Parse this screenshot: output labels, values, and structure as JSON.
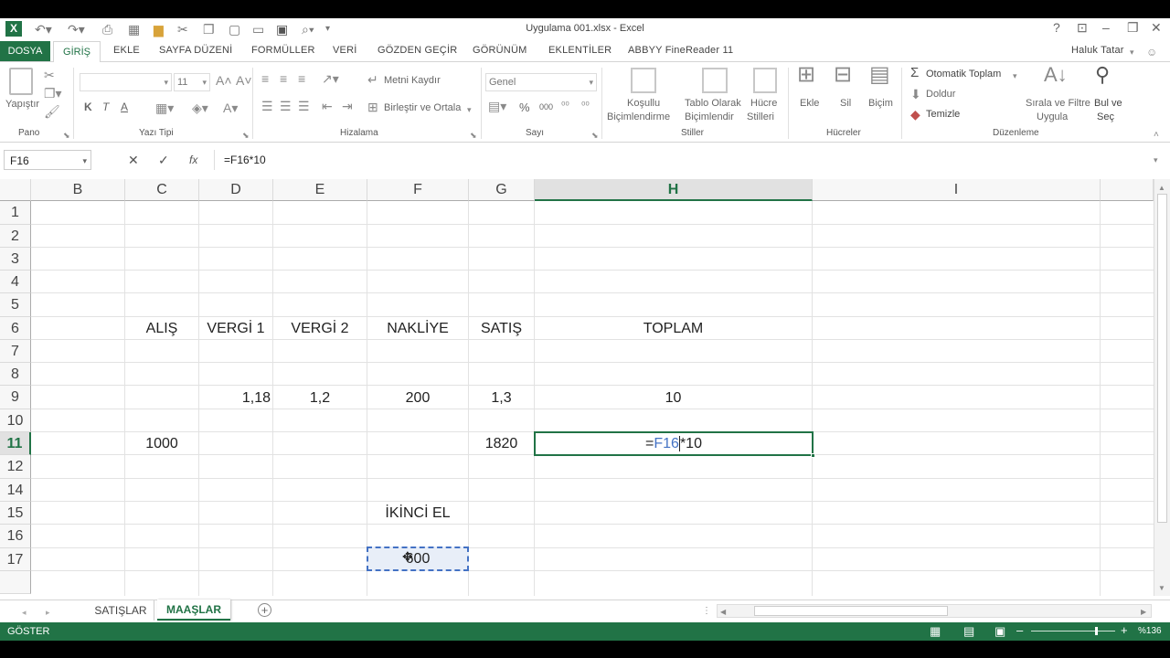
{
  "window": {
    "title": "Uygulama 001.xlsx - Excel",
    "user": "Haluk Tatar"
  },
  "ribbon_tabs": [
    "DOSYA",
    "GİRİŞ",
    "EKLE",
    "SAYFA DÜZENİ",
    "FORMÜLLER",
    "VERİ",
    "GÖZDEN GEÇİR",
    "GÖRÜNÜM",
    "EKLENTİLER",
    "ABBYY FineReader 11"
  ],
  "ribbon": {
    "pano": {
      "paste": "Yapıştır",
      "label": "Pano"
    },
    "font": {
      "size": "11",
      "bold": "K",
      "italic": "T",
      "underline": "A",
      "label": "Yazı Tipi"
    },
    "align": {
      "wrap": "Metni Kaydır",
      "merge": "Birleştir ve Ortala",
      "label": "Hizalama"
    },
    "number": {
      "format": "Genel",
      "percent": "%",
      "thousands": "000",
      "label": "Sayı"
    },
    "styles": {
      "cond_1": "Koşullu",
      "cond_2": "Biçimlendirme",
      "table_1": "Tablo Olarak",
      "table_2": "Biçimlendir",
      "cell_1": "Hücre",
      "cell_2": "Stilleri",
      "label": "Stiller"
    },
    "cells": {
      "insert": "Ekle",
      "delete": "Sil",
      "format": "Biçim",
      "label": "Hücreler"
    },
    "editing": {
      "autosum": "Otomatik Toplam",
      "fill": "Doldur",
      "clear": "Temizle",
      "sort_1": "Sırala ve Filtre",
      "sort_2": "Uygula",
      "find_1": "Bul ve",
      "find_2": "Seç",
      "label": "Düzenleme"
    }
  },
  "formula_bar": {
    "name_box": "F16",
    "fx": "fx",
    "formula": "=F16*10"
  },
  "columns": [
    "B",
    "C",
    "D",
    "E",
    "F",
    "G",
    "H",
    "I"
  ],
  "rows": [
    "1",
    "2",
    "3",
    "4",
    "5",
    "6",
    "7",
    "8",
    "9",
    "10",
    "11",
    "12",
    "14",
    "15",
    "16",
    "17"
  ],
  "cells": {
    "C6": "ALIŞ",
    "D6": "VERGİ 1",
    "E6": "VERGİ 2",
    "F6": "NAKLİYE",
    "G6": "SATIŞ",
    "H6": "TOPLAM",
    "D9": "1,18",
    "E9": "1,2",
    "F9": "200",
    "G9": "1,3",
    "H9": "10",
    "C11": "1000",
    "G11": "1820",
    "H11_eq": "=",
    "H11_ref": "F16",
    "H11_rest": "*10",
    "F14": "İKİNCİ EL",
    "F16": "600"
  },
  "sheets": [
    "SATIŞLAR",
    "MAAŞLAR"
  ],
  "status": {
    "mode": "GÖSTER",
    "zoom": "%136"
  },
  "colors": {
    "excel_green": "#217346",
    "ref_blue": "#4472c4"
  }
}
